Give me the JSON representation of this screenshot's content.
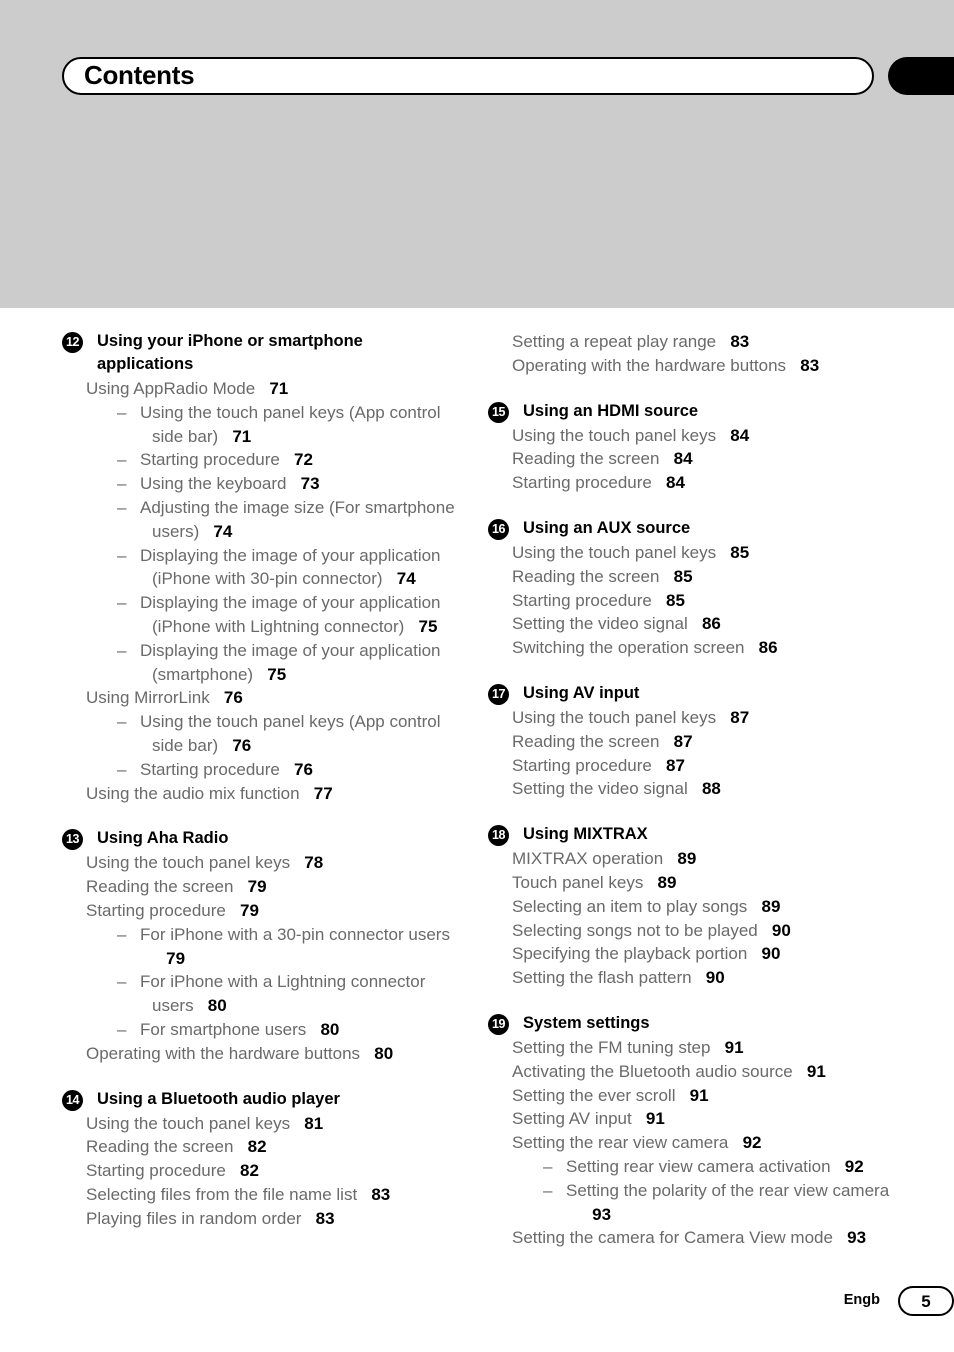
{
  "page": {
    "title": "Contents",
    "language_code": "Engb",
    "page_number": "5",
    "banner_color": "#cccccc",
    "accent_color": "#000000"
  },
  "columns": {
    "left": [
      {
        "number": "12",
        "heading": "Using your iPhone or smartphone applications",
        "entries": [
          {
            "level": 0,
            "text": "Using AppRadio Mode",
            "page": "71"
          },
          {
            "level": 1,
            "text": "Using the touch panel keys (App control side bar)",
            "page": "71"
          },
          {
            "level": 1,
            "text": "Starting procedure",
            "page": "72"
          },
          {
            "level": 1,
            "text": "Using the keyboard",
            "page": "73"
          },
          {
            "level": 1,
            "text": "Adjusting the image size (For smartphone users)",
            "page": "74"
          },
          {
            "level": 1,
            "text": "Displaying the image of your application (iPhone with 30-pin connector)",
            "page": "74"
          },
          {
            "level": 1,
            "text": "Displaying the image of your application (iPhone with Lightning connector)",
            "page": "75"
          },
          {
            "level": 1,
            "text": "Displaying the image of your application (smartphone)",
            "page": "75"
          },
          {
            "level": 0,
            "text": "Using MirrorLink",
            "page": "76"
          },
          {
            "level": 1,
            "text": "Using the touch panel keys (App control side bar)",
            "page": "76"
          },
          {
            "level": 1,
            "text": "Starting procedure",
            "page": "76"
          },
          {
            "level": 0,
            "text": "Using the audio mix function",
            "page": "77"
          }
        ]
      },
      {
        "number": "13",
        "heading": "Using Aha Radio",
        "entries": [
          {
            "level": 0,
            "text": "Using the touch panel keys",
            "page": "78"
          },
          {
            "level": 0,
            "text": "Reading the screen",
            "page": "79"
          },
          {
            "level": 0,
            "text": "Starting procedure",
            "page": "79"
          },
          {
            "level": 1,
            "text": "For iPhone with a 30-pin connector users",
            "page": "79"
          },
          {
            "level": 1,
            "text": "For iPhone with a Lightning connector users",
            "page": "80"
          },
          {
            "level": 1,
            "text": "For smartphone users",
            "page": "80"
          },
          {
            "level": 0,
            "text": "Operating with the hardware buttons",
            "page": "80"
          }
        ]
      },
      {
        "number": "14",
        "heading": "Using a Bluetooth audio player",
        "entries": [
          {
            "level": 0,
            "text": "Using the touch panel keys",
            "page": "81"
          },
          {
            "level": 0,
            "text": "Reading the screen",
            "page": "82"
          },
          {
            "level": 0,
            "text": "Starting procedure",
            "page": "82"
          },
          {
            "level": 0,
            "text": "Selecting files from the file name list",
            "page": "83"
          },
          {
            "level": 0,
            "text": "Playing files in random order",
            "page": "83"
          }
        ]
      }
    ],
    "right": [
      {
        "number": "",
        "heading": "",
        "entries": [
          {
            "level": 0,
            "text": "Setting a repeat play range",
            "page": "83"
          },
          {
            "level": 0,
            "text": "Operating with the hardware buttons",
            "page": "83"
          }
        ]
      },
      {
        "number": "15",
        "heading": "Using an HDMI source",
        "entries": [
          {
            "level": 0,
            "text": "Using the touch panel keys",
            "page": "84"
          },
          {
            "level": 0,
            "text": "Reading the screen",
            "page": "84"
          },
          {
            "level": 0,
            "text": "Starting procedure",
            "page": "84"
          }
        ]
      },
      {
        "number": "16",
        "heading": "Using an AUX source",
        "entries": [
          {
            "level": 0,
            "text": "Using the touch panel keys",
            "page": "85"
          },
          {
            "level": 0,
            "text": "Reading the screen",
            "page": "85"
          },
          {
            "level": 0,
            "text": "Starting procedure",
            "page": "85"
          },
          {
            "level": 0,
            "text": "Setting the video signal",
            "page": "86"
          },
          {
            "level": 0,
            "text": "Switching the operation screen",
            "page": "86"
          }
        ]
      },
      {
        "number": "17",
        "heading": "Using AV input",
        "entries": [
          {
            "level": 0,
            "text": "Using the touch panel keys",
            "page": "87"
          },
          {
            "level": 0,
            "text": "Reading the screen",
            "page": "87"
          },
          {
            "level": 0,
            "text": "Starting procedure",
            "page": "87"
          },
          {
            "level": 0,
            "text": "Setting the video signal",
            "page": "88"
          }
        ]
      },
      {
        "number": "18",
        "heading": "Using MIXTRAX",
        "entries": [
          {
            "level": 0,
            "text": "MIXTRAX operation",
            "page": "89"
          },
          {
            "level": 0,
            "text": "Touch panel keys",
            "page": "89"
          },
          {
            "level": 0,
            "text": "Selecting an item to play songs",
            "page": "89"
          },
          {
            "level": 0,
            "text": "Selecting songs not to be played",
            "page": "90"
          },
          {
            "level": 0,
            "text": "Specifying the playback portion",
            "page": "90"
          },
          {
            "level": 0,
            "text": "Setting the flash pattern",
            "page": "90"
          }
        ]
      },
      {
        "number": "19",
        "heading": "System settings",
        "entries": [
          {
            "level": 0,
            "text": "Setting the FM tuning step",
            "page": "91"
          },
          {
            "level": 0,
            "text": "Activating the Bluetooth audio source",
            "page": "91"
          },
          {
            "level": 0,
            "text": "Setting the ever scroll",
            "page": "91"
          },
          {
            "level": 0,
            "text": "Setting AV input",
            "page": "91"
          },
          {
            "level": 0,
            "text": "Setting the rear view camera",
            "page": "92"
          },
          {
            "level": 1,
            "text": "Setting rear view camera activation",
            "page": "92"
          },
          {
            "level": 1,
            "text": "Setting the polarity of the rear view camera",
            "page": "93"
          },
          {
            "level": 0,
            "text": "Setting the camera for Camera View mode",
            "page": "93"
          }
        ]
      }
    ]
  }
}
